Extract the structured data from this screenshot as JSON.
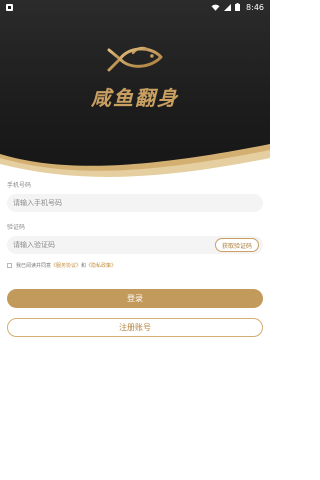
{
  "status_bar": {
    "time": "8:46",
    "icons": [
      "app-notification-icon",
      "wifi-icon",
      "signal-icon",
      "battery-icon"
    ]
  },
  "brand": {
    "name": "咸鱼翻身",
    "logo_icon": "fish-logo-icon",
    "gold": "#c9a062"
  },
  "form": {
    "phone": {
      "label": "手机号码",
      "placeholder": "请输入手机号码",
      "value": ""
    },
    "code": {
      "label": "验证码",
      "placeholder": "请输入验证码",
      "value": "",
      "button_label": "获取验证码"
    },
    "agreement": {
      "prefix": "我已阅读并同意",
      "service_link": "《服务协议》",
      "and": "和",
      "privacy_link": "《隐私政策》",
      "checked": false
    },
    "login_label": "登录",
    "register_label": "注册账号"
  },
  "colors": {
    "accent": "#c29a5b",
    "header_dark": "#1c1c1c"
  }
}
